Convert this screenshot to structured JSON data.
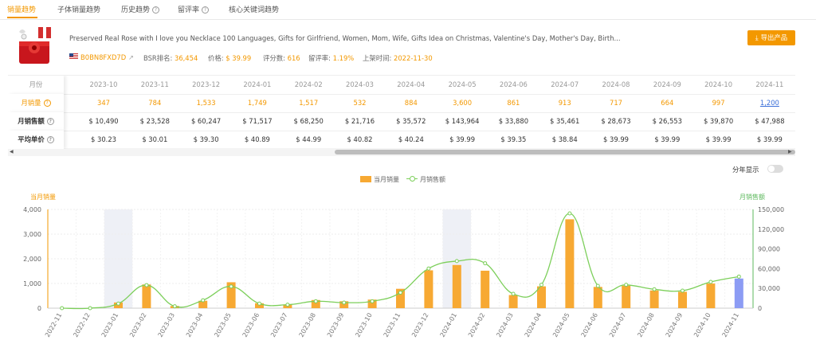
{
  "tabs": [
    {
      "label": "销量趋势",
      "active": true,
      "help": false
    },
    {
      "label": "子体销量趋势",
      "active": false,
      "help": false
    },
    {
      "label": "历史趋势",
      "active": false,
      "help": true
    },
    {
      "label": "留评率",
      "active": false,
      "help": true
    },
    {
      "label": "核心关键词趋势",
      "active": false,
      "help": false
    }
  ],
  "product": {
    "title": "Preserved Real Rose with I love you Necklace 100 Languages, Gifts for Girlfriend, Women, Mom, Wife, Gifts Idea on Christmas, Valentine's Day, Mother's Day, Birth...",
    "asin": "B0BN8FXD7D",
    "bsr_label": "BSR排名:",
    "bsr_value": "36,454",
    "price_label": "价格:",
    "price_value": "$ 39.99",
    "reviews_label": "评分数:",
    "reviews_value": "616",
    "rate_label": "留评率:",
    "rate_value": "1.19%",
    "launch_label": "上架时间:",
    "launch_value": "2022-11-30",
    "export_label": "导出产品"
  },
  "table": {
    "row_labels": {
      "month": "月份",
      "sales": "月销量",
      "revenue": "月销售额",
      "price": "平均单价"
    },
    "partial": {
      "sales": "97",
      "revenue": "07",
      "price": "99"
    },
    "months": [
      "2023-10",
      "2023-11",
      "2023-12",
      "2024-01",
      "2024-02",
      "2024-03",
      "2024-04",
      "2024-05",
      "2024-06",
      "2024-07",
      "2024-08",
      "2024-09",
      "2024-10",
      "2024-11"
    ],
    "sales": [
      "347",
      "784",
      "1,533",
      "1,749",
      "1,517",
      "532",
      "884",
      "3,600",
      "861",
      "913",
      "717",
      "664",
      "997",
      "1,200"
    ],
    "revenue": [
      "$ 10,490",
      "$ 23,528",
      "$ 60,247",
      "$ 71,517",
      "$ 68,250",
      "$ 21,716",
      "$ 35,572",
      "$ 143,964",
      "$ 33,880",
      "$ 35,461",
      "$ 28,673",
      "$ 26,553",
      "$ 39,870",
      "$ 47,988"
    ],
    "price": [
      "$ 30.23",
      "$ 30.01",
      "$ 39.30",
      "$ 40.89",
      "$ 44.99",
      "$ 40.82",
      "$ 40.24",
      "$ 39.99",
      "$ 39.35",
      "$ 38.84",
      "$ 39.99",
      "$ 39.99",
      "$ 39.99",
      "$ 39.99"
    ]
  },
  "controls": {
    "year_toggle_label": "分年显示",
    "year_toggle_on": false
  },
  "chart_data": {
    "type": "bar+line",
    "legend": [
      "当月销量",
      "月销售额"
    ],
    "y_left_label": "当月销量",
    "y_right_label": "月销售额",
    "y_left_ticks": [
      "0",
      "1,000",
      "2,000",
      "3,000",
      "4,000"
    ],
    "y_right_ticks": [
      "0",
      "30,000",
      "60,000",
      "90,000",
      "120,000",
      "150,000"
    ],
    "ylim_left": [
      0,
      4000
    ],
    "ylim_right": [
      0,
      150000
    ],
    "categories": [
      "2022-11",
      "2022-12",
      "2023-01",
      "2023-02",
      "2023-03",
      "2023-04",
      "2023-05",
      "2023-06",
      "2023-07",
      "2023-08",
      "2023-09",
      "2023-10",
      "2023-11",
      "2023-12",
      "2024-01",
      "2024-02",
      "2024-03",
      "2024-04",
      "2024-05",
      "2024-06",
      "2024-07",
      "2024-08",
      "2024-09",
      "2024-10",
      "2024-11"
    ],
    "series": [
      {
        "name": "当月销量",
        "kind": "bar",
        "values": [
          0,
          0,
          230,
          960,
          90,
          300,
          1050,
          200,
          150,
          330,
          280,
          347,
          784,
          1533,
          1749,
          1517,
          532,
          884,
          3600,
          861,
          913,
          717,
          664,
          997,
          1200
        ]
      },
      {
        "name": "月销售额",
        "kind": "line",
        "values": [
          0,
          0,
          7000,
          35000,
          2800,
          12000,
          33000,
          7000,
          5300,
          10500,
          8400,
          10490,
          23528,
          60247,
          71517,
          68250,
          21716,
          35572,
          143964,
          33880,
          35461,
          28673,
          26553,
          39870,
          47988
        ]
      }
    ],
    "highlight_categories": [
      "2023-01",
      "2024-01"
    ],
    "colors": {
      "bar": "#f7a933",
      "bar_current": "#8c9cf4",
      "line": "#7ccf5a",
      "left_axis": "#f39800",
      "right_axis": "#5cb85c",
      "highlight": "#eef0f6"
    }
  }
}
